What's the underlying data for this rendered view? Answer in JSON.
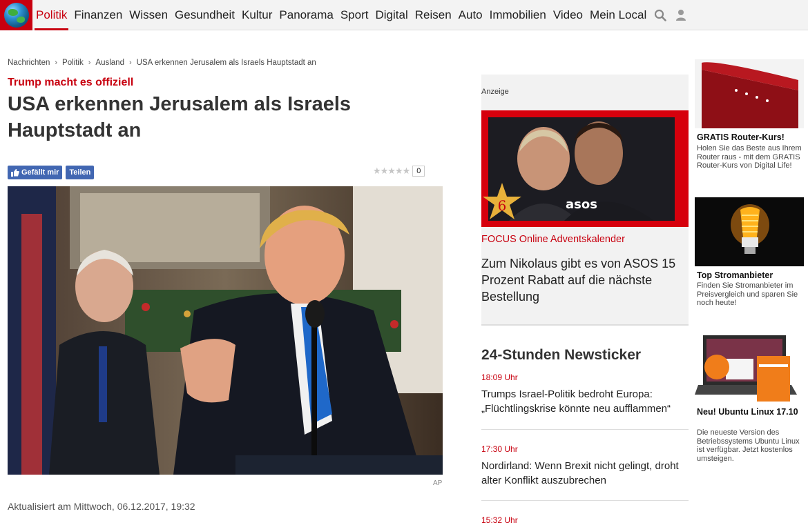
{
  "nav": {
    "items": [
      "Politik",
      "Finanzen",
      "Wissen",
      "Gesundheit",
      "Kultur",
      "Panorama",
      "Sport",
      "Digital",
      "Reisen",
      "Auto",
      "Immobilien",
      "Video",
      "Mein Local"
    ],
    "active": "Politik",
    "accent": "#c8000f"
  },
  "breadcrumb": [
    "Nachrichten",
    "Politik",
    "Ausland",
    "USA erkennen Jerusalem als Israels Hauptstadt an"
  ],
  "article": {
    "kicker": "Trump macht es offiziell",
    "headline": "USA erkennen Jerusalem als Israels Hauptstadt an",
    "like_label": "Gefällt mir",
    "share_label": "Teilen",
    "rating_count": "0",
    "image_credit": "AP",
    "updated": "Aktualisiert am Mittwoch, 06.12.2017, 19:32"
  },
  "ad": {
    "label": "Anzeige",
    "badge_number": "6",
    "brand": "asos",
    "subtitle": "FOCUS Online Adventskalender",
    "text": "Zum Nikolaus gibt es von ASOS 15 Prozent Rabatt auf die nächste Bestellung"
  },
  "ticker": {
    "title": "24-Stunden Newsticker",
    "items": [
      {
        "time": "18:09 Uhr",
        "text": "Trumps Israel-Politik bedroht Europa: „Flüchtlingskrise könnte neu aufflammen“"
      },
      {
        "time": "17:30 Uhr",
        "text": "Nordirland: Wenn Brexit nicht gelingt, droht alter Konflikt auszubrechen"
      },
      {
        "time": "15:32 Uhr",
        "text": ""
      }
    ]
  },
  "sidebar": [
    {
      "title": "GRATIS Router-Kurs!",
      "text": "Holen Sie das Beste aus Ihrem Router raus - mit dem GRATIS Router-Kurs von Digital Life!"
    },
    {
      "title": "Top Stromanbieter",
      "text": "Finden Sie Stromanbieter im Preisvergleich und sparen Sie noch heute!"
    },
    {
      "title": "Neu! Ubuntu Linux 17.10",
      "text": "Die neueste Version des Betriebssystems Ubuntu Linux ist verfügbar. Jetzt kostenlos umsteigen."
    }
  ]
}
